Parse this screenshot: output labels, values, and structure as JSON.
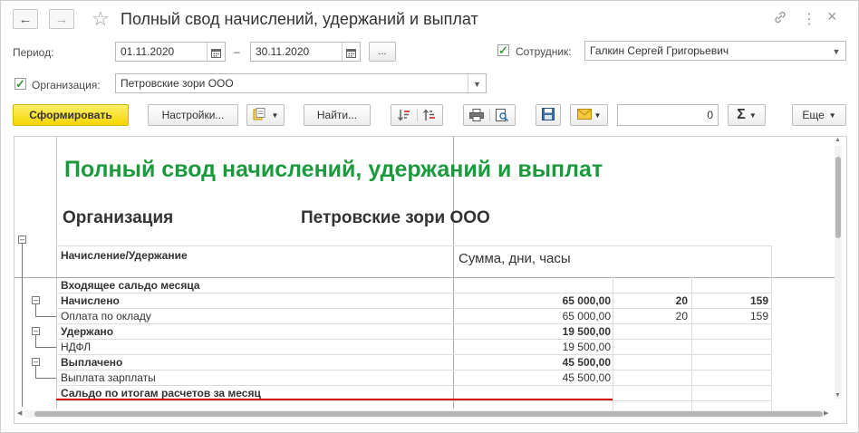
{
  "window": {
    "title": "Полный свод начислений, удержаний и выплат",
    "back_icon": "←",
    "forward_icon": "→",
    "star_icon": "☆",
    "link_icon": "🔗",
    "menu_icon": "⋮",
    "close_icon": "×"
  },
  "filters": {
    "period_label": "Период:",
    "period_from": "01.11.2020",
    "period_dash": "–",
    "period_to": "30.11.2020",
    "period_more": "...",
    "employee_label": "Сотрудник:",
    "employee_value": "Галкин Сергей Григорьевич",
    "organization_label": "Организация:",
    "organization_value": "Петровские зори ООО"
  },
  "toolbar": {
    "generate_label": "Сформировать",
    "settings_label": "Настройки...",
    "find_label": "Найти...",
    "number_value": "0",
    "sum_icon": "Σ",
    "more_label": "Еще"
  },
  "report": {
    "title": "Полный свод начислений, удержаний и выплат",
    "org_label": "Организация",
    "org_value": "Петровские зори ООО",
    "col_header_1": "Начисление/Удержание",
    "col_header_2": "Сумма, дни, часы",
    "rows": [
      {
        "label": "Входящее сальдо месяца",
        "bold": true,
        "sum": "",
        "days": "",
        "hours": ""
      },
      {
        "label": "Начислено",
        "bold": true,
        "sum": "65 000,00",
        "days": "20",
        "hours": "159"
      },
      {
        "label": "Оплата по окладу",
        "bold": false,
        "sum": "65 000,00",
        "days": "20",
        "hours": "159"
      },
      {
        "label": "Удержано",
        "bold": true,
        "sum": "19 500,00",
        "days": "",
        "hours": ""
      },
      {
        "label": "НДФЛ",
        "bold": false,
        "sum": "19 500,00",
        "days": "",
        "hours": ""
      },
      {
        "label": "Выплачено",
        "bold": true,
        "sum": "45 500,00",
        "days": "",
        "hours": ""
      },
      {
        "label": "Выплата зарплаты",
        "bold": false,
        "sum": "45 500,00",
        "days": "",
        "hours": ""
      },
      {
        "label": "Сальдо по итогам расчетов за месяц",
        "bold": true,
        "sum": "",
        "days": "",
        "hours": ""
      }
    ]
  },
  "colors": {
    "title_green": "#1a9a3c",
    "primary_yellow": "#f5d600",
    "underline_red": "#d40000"
  }
}
